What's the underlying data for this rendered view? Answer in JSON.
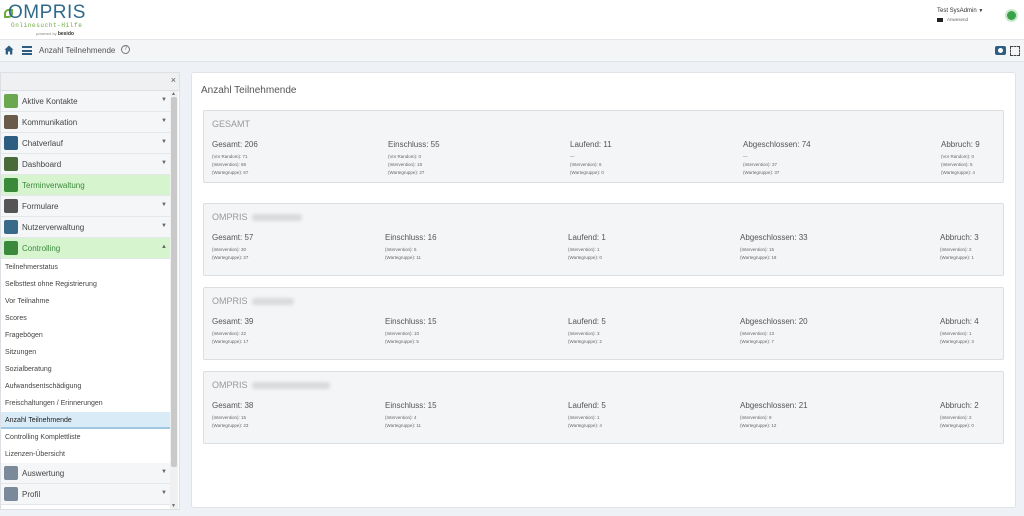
{
  "header": {
    "logo_main": "OMPRIS",
    "logo_sub": "Onlinesucht-Hilfe",
    "logo_powered_by": "powered by",
    "logo_brand": "besido",
    "user_name": "Test SysAdmin",
    "user_status": "Anwesend"
  },
  "toolbar": {
    "breadcrumb": "Anzahl Teilnehmende",
    "help": "?"
  },
  "sidebar": {
    "close": "×",
    "items_top": [
      {
        "label": "Aktive Kontakte",
        "icon": "magnifier-icon",
        "color": "#6aa84f"
      },
      {
        "label": "Kommunikation",
        "icon": "people-icon",
        "color": "#6a5a4a"
      },
      {
        "label": "Chatverlauf",
        "icon": "chat-icon",
        "color": "#2d5d80"
      },
      {
        "label": "Dashboard",
        "icon": "dashboard-icon",
        "color": "#4a6a3a"
      },
      {
        "label": "Terminverwaltung",
        "icon": "calendar-icon",
        "color": "#3b8a3b"
      },
      {
        "label": "Formulare",
        "icon": "form-icon",
        "color": "#555555"
      },
      {
        "label": "Nutzerverwaltung",
        "icon": "user-gear-icon",
        "color": "#3a6a8a"
      },
      {
        "label": "Controlling",
        "icon": "chart-icon",
        "color": "#3b8a3b"
      }
    ],
    "sub_items": [
      "Teilnehmerstatus",
      "Selbsttest ohne Registrierung",
      "Vor Teilnahme",
      "Scores",
      "Fragebögen",
      "Sitzungen",
      "Sozialberatung",
      "Aufwandsentschädigung",
      "Freischaltungen / Erinnerungen",
      "Anzahl Teilnehmende",
      "Controlling Komplettliste",
      "Lizenzen-Übersicht"
    ],
    "items_bottom": [
      {
        "label": "Auswertung",
        "icon": "clipboard-icon"
      },
      {
        "label": "Profil",
        "icon": "profile-icon"
      }
    ]
  },
  "main": {
    "title": "Anzahl Teilnehmende",
    "cards": [
      {
        "title": "GESAMT",
        "columns": [
          {
            "head": "Gesamt: 206",
            "subs": [
              "(Vor Random): 71",
              "(Intervention): 68",
              "(Wartegruppe): 67"
            ]
          },
          {
            "head": "Einschluss: 55",
            "subs": [
              "(Vor Random): 0",
              "(Intervention): 18",
              "(Wartegruppe): 27"
            ]
          },
          {
            "head": "Laufend: 11",
            "subs": [
              "—",
              "(Intervention): 6",
              "(Wartegruppe): 0"
            ]
          },
          {
            "head": "Abgeschlossen: 74",
            "subs": [
              "—",
              "(Intervention): 37",
              "(Wartegruppe): 37"
            ]
          },
          {
            "head": "Abbruch: 9",
            "subs": [
              "(Vor Random): 0",
              "(Intervention): 5",
              "(Wartegruppe): 4"
            ]
          }
        ]
      },
      {
        "title": "OMPRIS",
        "columns": [
          {
            "head": "Gesamt: 57",
            "subs": [
              "(Intervention): 30",
              "(Wartegruppe): 27"
            ]
          },
          {
            "head": "Einschluss: 16",
            "subs": [
              "(Intervention): 5",
              "(Wartegruppe): 11"
            ]
          },
          {
            "head": "Laufend: 1",
            "subs": [
              "(Intervention): 1",
              "(Wartegruppe): 0"
            ]
          },
          {
            "head": "Abgeschlossen: 33",
            "subs": [
              "(Intervention): 15",
              "(Wartegruppe): 18"
            ]
          },
          {
            "head": "Abbruch: 3",
            "subs": [
              "(Intervention): 2",
              "(Wartegruppe): 1"
            ]
          }
        ]
      },
      {
        "title": "OMPRIS",
        "columns": [
          {
            "head": "Gesamt: 39",
            "subs": [
              "(Intervention): 22",
              "(Wartegruppe): 17"
            ]
          },
          {
            "head": "Einschluss: 15",
            "subs": [
              "(Intervention): 10",
              "(Wartegruppe): 5"
            ]
          },
          {
            "head": "Laufend: 5",
            "subs": [
              "(Intervention): 3",
              "(Wartegruppe): 2"
            ]
          },
          {
            "head": "Abgeschlossen: 20",
            "subs": [
              "(Intervention): 13",
              "(Wartegruppe): 7"
            ]
          },
          {
            "head": "Abbruch: 4",
            "subs": [
              "(Intervention): 1",
              "(Wartegruppe): 3"
            ]
          }
        ]
      },
      {
        "title": "OMPRIS",
        "columns": [
          {
            "head": "Gesamt: 38",
            "subs": [
              "(Intervention): 15",
              "(Wartegruppe): 23"
            ]
          },
          {
            "head": "Einschluss: 15",
            "subs": [
              "(Intervention): 4",
              "(Wartegruppe): 11"
            ]
          },
          {
            "head": "Laufend: 5",
            "subs": [
              "(Intervention): 1",
              "(Wartegruppe): 4"
            ]
          },
          {
            "head": "Abgeschlossen: 21",
            "subs": [
              "(Intervention): 9",
              "(Wartegruppe): 12"
            ]
          },
          {
            "head": "Abbruch: 2",
            "subs": [
              "(Intervention): 2",
              "(Wartegruppe): 0"
            ]
          }
        ]
      }
    ]
  }
}
